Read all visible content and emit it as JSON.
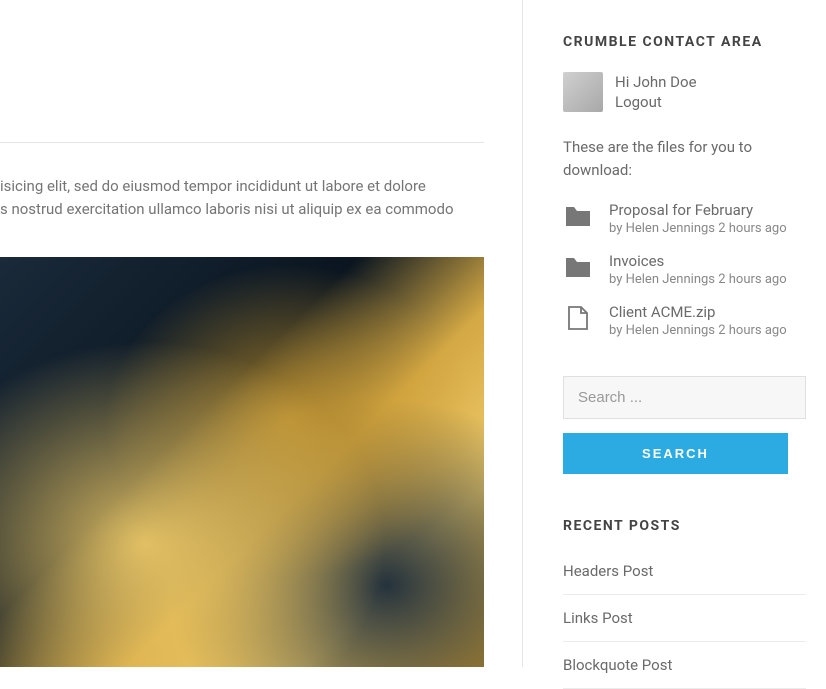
{
  "article": {
    "text_line1": "isicing elit, sed do eiusmod tempor incididunt ut labore et dolore",
    "text_line2": "s nostrud exercitation ullamco laboris nisi ut aliquip ex ea commodo"
  },
  "sidebar": {
    "contact_title": "CRUMBLE CONTACT AREA",
    "greeting": "Hi John Doe",
    "logout": "Logout",
    "intro": "These are the files for you to download:",
    "files": [
      {
        "name": "Proposal for February",
        "meta": "by Helen Jennings 2 hours ago",
        "type": "folder"
      },
      {
        "name": "Invoices",
        "meta": "by Helen Jennings 2 hours ago",
        "type": "folder"
      },
      {
        "name": "Client ACME.zip",
        "meta": "by Helen Jennings 2 hours ago",
        "type": "file"
      }
    ],
    "search_placeholder": "Search ...",
    "search_button": "SEARCH",
    "recent_title": "RECENT POSTS",
    "posts": [
      "Headers Post",
      "Links Post",
      "Blockquote Post"
    ]
  }
}
